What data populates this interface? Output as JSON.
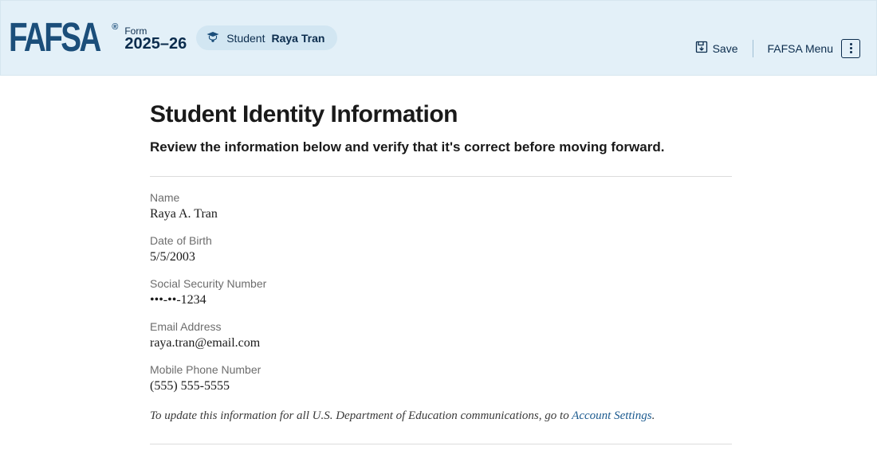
{
  "header": {
    "logo_text": "FAFSA",
    "reg_mark": "®",
    "form_label": "Form",
    "year": "2025–26",
    "chip_role": "Student",
    "chip_name": "Raya Tran",
    "save_label": "Save",
    "menu_label": "FAFSA Menu"
  },
  "page": {
    "title": "Student Identity Information",
    "subtitle": "Review the information below and verify that it's correct before moving forward."
  },
  "fields": {
    "name": {
      "label": "Name",
      "value": "Raya A. Tran"
    },
    "dob": {
      "label": "Date of Birth",
      "value": "5/5/2003"
    },
    "ssn": {
      "label": "Social Security Number",
      "value": "•••-••-1234"
    },
    "email": {
      "label": "Email Address",
      "value": "raya.tran@email.com"
    },
    "phone": {
      "label": "Mobile Phone Number",
      "value": "(555) 555-5555"
    }
  },
  "note": {
    "prefix": "To update this information for all U.S. Department of Education communications, go to ",
    "link_text": "Account Settings",
    "suffix": "."
  }
}
